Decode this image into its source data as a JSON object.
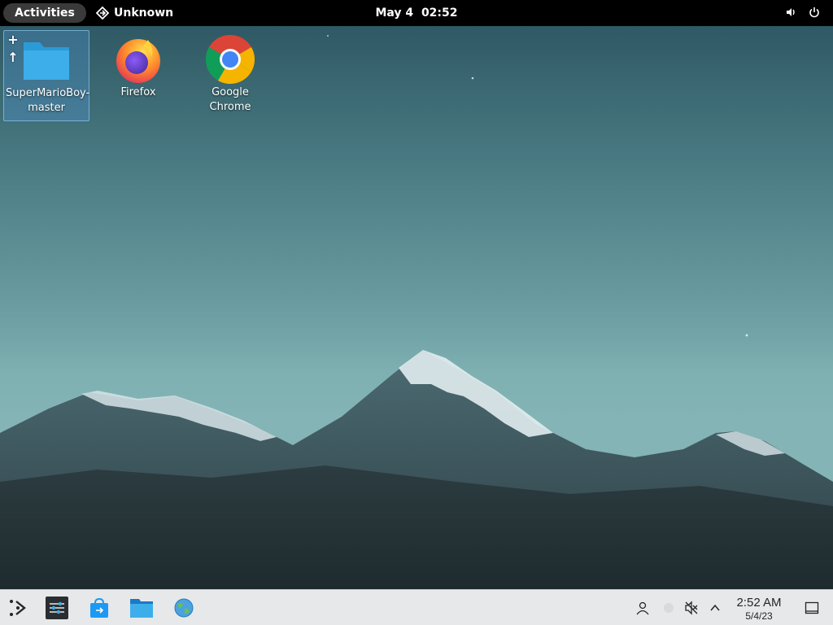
{
  "topbar": {
    "activities_label": "Activities",
    "app_name": "Unknown",
    "date": "May 4",
    "time": "02:52"
  },
  "desktop": {
    "icons": [
      {
        "label_line1": "SuperMarioBoy-",
        "label_line2": "master",
        "icon": "folder-icon",
        "selected": true
      },
      {
        "label": "Firefox",
        "icon": "firefox-icon"
      },
      {
        "label": "Google Chrome",
        "icon": "chrome-icon"
      }
    ],
    "selection_tools": {
      "add": "+",
      "open": "↑"
    }
  },
  "taskbar": {
    "clock_time": "2:52 AM",
    "clock_date": "5/4/23",
    "items": [
      "application-launcher-icon",
      "system-settings-icon",
      "discover-store-icon",
      "file-manager-icon",
      "web-browser-icon"
    ],
    "tray": [
      "user-icon",
      "network-icon",
      "volume-muted-icon",
      "expand-tray-icon",
      "show-desktop-icon"
    ]
  },
  "colors": {
    "topbar_bg": "#000000",
    "taskbar_bg": "#e6e8ea",
    "folder_blue": "#3daee9"
  }
}
